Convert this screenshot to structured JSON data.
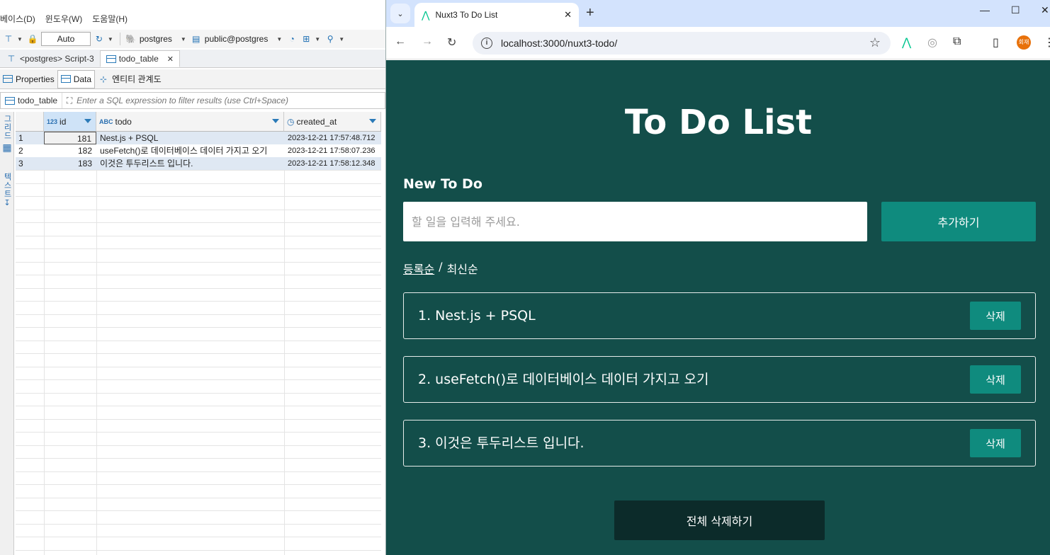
{
  "dbeaver": {
    "menu": [
      "베이스(D)",
      "윈도우(W)",
      "도움말(H)"
    ],
    "toolbar": {
      "commit_mode": "Auto",
      "connection": "postgres",
      "schema": "public@postgres"
    },
    "editor_tabs": [
      {
        "label": "<postgres> Script-3"
      },
      {
        "label": "todo_table",
        "active": true
      }
    ],
    "sub_tabs": [
      "Properties",
      "Data",
      "엔티티 관계도"
    ],
    "filter": {
      "table": "todo_table",
      "placeholder": "Enter a SQL expression to filter results (use Ctrl+Space)"
    },
    "side_labels": {
      "grid": "그리드",
      "text": "텍스트"
    },
    "grid": {
      "columns": [
        {
          "type": "123",
          "name": "id"
        },
        {
          "type": "ABC",
          "name": "todo"
        },
        {
          "type": "clock",
          "name": "created_at"
        }
      ],
      "rows": [
        {
          "num": "1",
          "id": "181",
          "todo": "Nest.js + PSQL",
          "created_at": "2023-12-21 17:57:48.712"
        },
        {
          "num": "2",
          "id": "182",
          "todo": "useFetch()로 데이터베이스 데이터 가지고 오기",
          "created_at": "2023-12-21 17:58:07.236"
        },
        {
          "num": "3",
          "id": "183",
          "todo": "이것은 투두리스트 입니다.",
          "created_at": "2023-12-21 17:58:12.348"
        }
      ]
    }
  },
  "browser": {
    "tab_title": "Nuxt3 To Do List",
    "url": "localhost:3000/nuxt3-todo/",
    "avatar_text": "회재"
  },
  "app": {
    "title": "To Do List",
    "new_label": "New To Do",
    "input_placeholder": "할 일을 입력해 주세요.",
    "add_label": "추가하기",
    "sort_active": "등록순",
    "sort_sep": "/",
    "sort_other": "최신순",
    "items": [
      {
        "text": "1. Nest.js + PSQL",
        "delete": "삭제"
      },
      {
        "text": "2. useFetch()로 데이터베이스 데이터 가지고 오기",
        "delete": "삭제"
      },
      {
        "text": "3. 이것은 투두리스트 입니다.",
        "delete": "삭제"
      }
    ],
    "clear_label": "전체 삭제하기"
  },
  "colors": {
    "page_bg": "#134e4a",
    "accent": "#0f8b7e",
    "clear_bg": "#0c2b2a"
  }
}
